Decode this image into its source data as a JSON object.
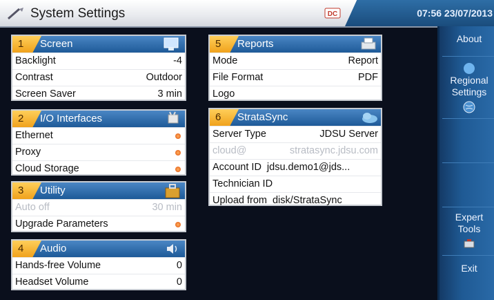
{
  "titlebar": {
    "title": "System Settings",
    "icon": "settings-wand-icon",
    "badge_icon": "dc-power-icon",
    "datetime": "07:56 23/07/2013"
  },
  "sidebar": {
    "about": "About",
    "regional": "Regional\nSettings",
    "expert": "Expert\nTools",
    "exit": "Exit"
  },
  "panels": {
    "screen": {
      "num": "1",
      "title": "Screen",
      "icon": "monitor-icon",
      "rows": [
        {
          "label": "Backlight",
          "value": "-4"
        },
        {
          "label": "Contrast",
          "value": "Outdoor"
        },
        {
          "label": "Screen Saver",
          "value": "3 min"
        }
      ]
    },
    "io": {
      "num": "2",
      "title": "I/O Interfaces",
      "icon": "plug-icon",
      "rows": [
        {
          "label": "Ethernet"
        },
        {
          "label": "Proxy"
        },
        {
          "label": "Cloud Storage"
        }
      ]
    },
    "utility": {
      "num": "3",
      "title": "Utility",
      "icon": "toolbox-icon",
      "rows": [
        {
          "label": "Auto off",
          "value": "30 min"
        },
        {
          "label": "Upgrade Parameters"
        }
      ]
    },
    "audio": {
      "num": "4",
      "title": "Audio",
      "icon": "speaker-icon",
      "rows": [
        {
          "label": "Hands-free Volume",
          "value": "0"
        },
        {
          "label": "Headset Volume",
          "value": "0"
        }
      ]
    },
    "reports": {
      "num": "5",
      "title": "Reports",
      "icon": "printer-icon",
      "rows": [
        {
          "label": "Mode",
          "value": "Report"
        },
        {
          "label": "File Format",
          "value": "PDF"
        },
        {
          "label": "Logo"
        }
      ]
    },
    "stratasync": {
      "num": "6",
      "title": "StrataSync",
      "icon": "cloud-icon",
      "rows": [
        {
          "label": "Server Type",
          "value": "JDSU Server"
        },
        {
          "label": "cloud@",
          "value": "stratasync.jdsu.com"
        },
        {
          "label": "Account ID",
          "value": "jdsu.demo1@jds..."
        },
        {
          "label": "Technician ID",
          "value": ""
        },
        {
          "label": "Upload from",
          "value": "disk/StrataSync"
        }
      ]
    }
  },
  "colors": {
    "header_blue": "#1e5a98",
    "number_tab": "#f0a21c",
    "background": "#0a0f1c",
    "sidebar_blue": "#1f5a94"
  }
}
